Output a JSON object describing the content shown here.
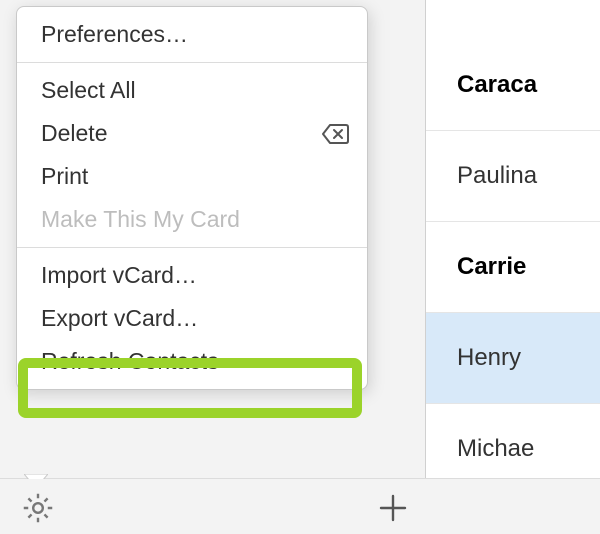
{
  "menu": {
    "preferences": "Preferences…",
    "select_all": "Select All",
    "delete": "Delete",
    "print": "Print",
    "make_my_card": "Make This My Card",
    "import_vcard": "Import vCard…",
    "export_vcard": "Export vCard…",
    "refresh_contacts": "Refresh Contacts"
  },
  "contacts": {
    "items": [
      {
        "label": "Caraca",
        "bold": true,
        "selected": false
      },
      {
        "label": "Paulina",
        "bold": false,
        "selected": false
      },
      {
        "label": "Carrie",
        "bold": true,
        "selected": false
      },
      {
        "label": "Henry",
        "bold": false,
        "selected": true
      },
      {
        "label": "Michae",
        "bold": false,
        "selected": false
      }
    ]
  },
  "icons": {
    "gear": "gear-icon",
    "plus": "plus-icon",
    "delete": "backspace-delete-icon"
  },
  "colors": {
    "highlight": "#9BD32A",
    "selected_row": "#d8e9f9"
  }
}
